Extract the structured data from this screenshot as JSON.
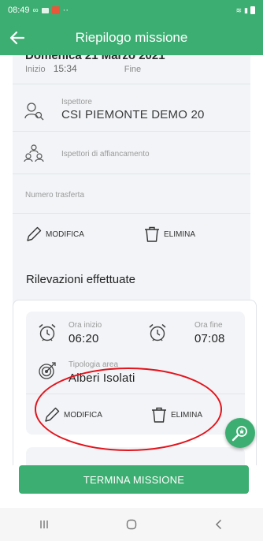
{
  "status_bar": {
    "time": "08:49",
    "notif": "∞ ▣ ·· "
  },
  "header": {
    "title": "Riepilogo missione"
  },
  "mission": {
    "date": "Domenica 21 Marzo 2021",
    "start_label": "Inizio",
    "start_time": "15:34",
    "end_label": "Fine",
    "inspector_label": "Ispettore",
    "inspector_value": "CSI PIEMONTE DEMO 20",
    "assistants_label": "Ispettori di affiancamento",
    "trip_label": "Numero trasferta",
    "edit_label": "MODIFICA",
    "delete_label": "ELIMINA"
  },
  "surveys": {
    "section_title": "Rilevazioni effettuate",
    "items": [
      {
        "start_label": "Ora inizio",
        "start_time": "06:20",
        "end_label": "Ora fine",
        "end_time": "07:08",
        "area_label": "Tipologia area",
        "area_value": "Alberi Isolati",
        "edit_label": "MODIFICA",
        "delete_label": "ELIMINA"
      }
    ]
  },
  "end_button": {
    "label": "TERMINA MISSIONE"
  },
  "colors": {
    "accent": "#3dae72",
    "annotation": "#e3131c"
  },
  "icons": [
    "back-arrow-icon",
    "inspector-icon",
    "team-icon",
    "pencil-icon",
    "trash-icon",
    "alarm-clock-icon",
    "target-icon",
    "search-bug-icon"
  ]
}
